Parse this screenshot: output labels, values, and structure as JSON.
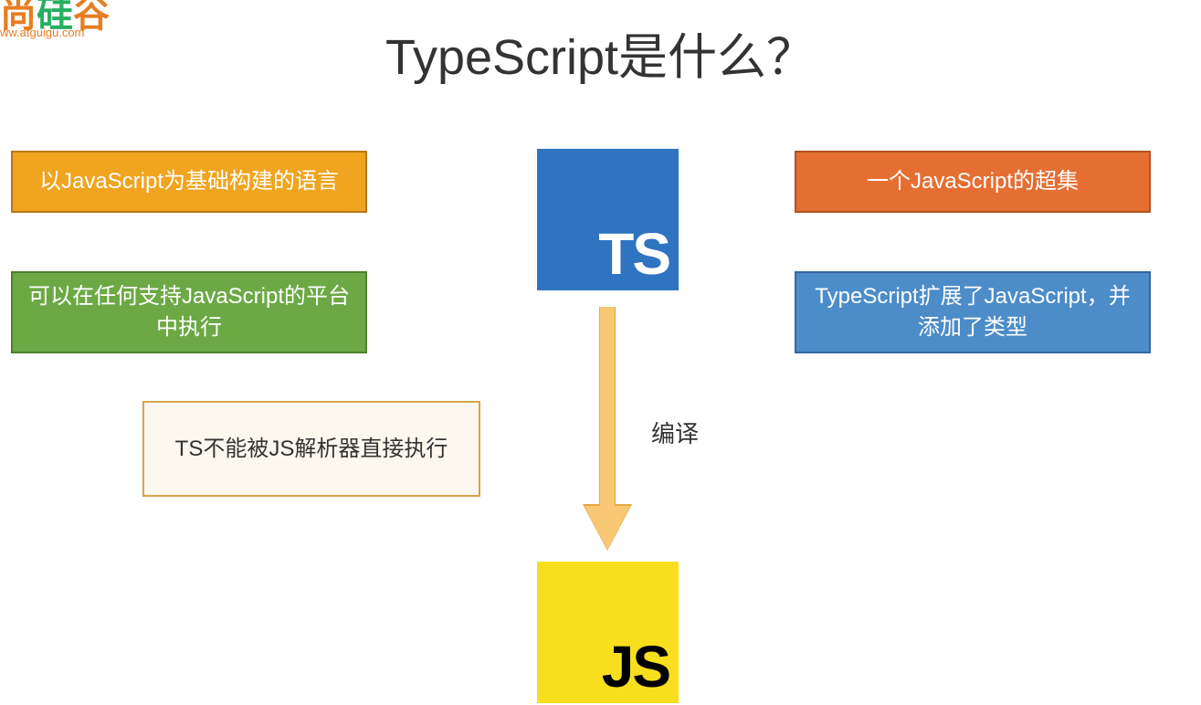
{
  "logo": {
    "chars": "尚硅谷",
    "url": "ww.atguigu.com"
  },
  "title": "TypeScript是什么？",
  "boxes": {
    "yellow": "以JavaScript为基础构建的语言",
    "green": "可以在任何支持JavaScript的平台中执行",
    "beige": "TS不能被JS解析器直接执行",
    "orange": "一个JavaScript的超集",
    "blue": "TypeScript扩展了JavaScript，并添加了类型"
  },
  "logos": {
    "ts": "TS",
    "js": "JS"
  },
  "arrow": {
    "label": "编译"
  }
}
